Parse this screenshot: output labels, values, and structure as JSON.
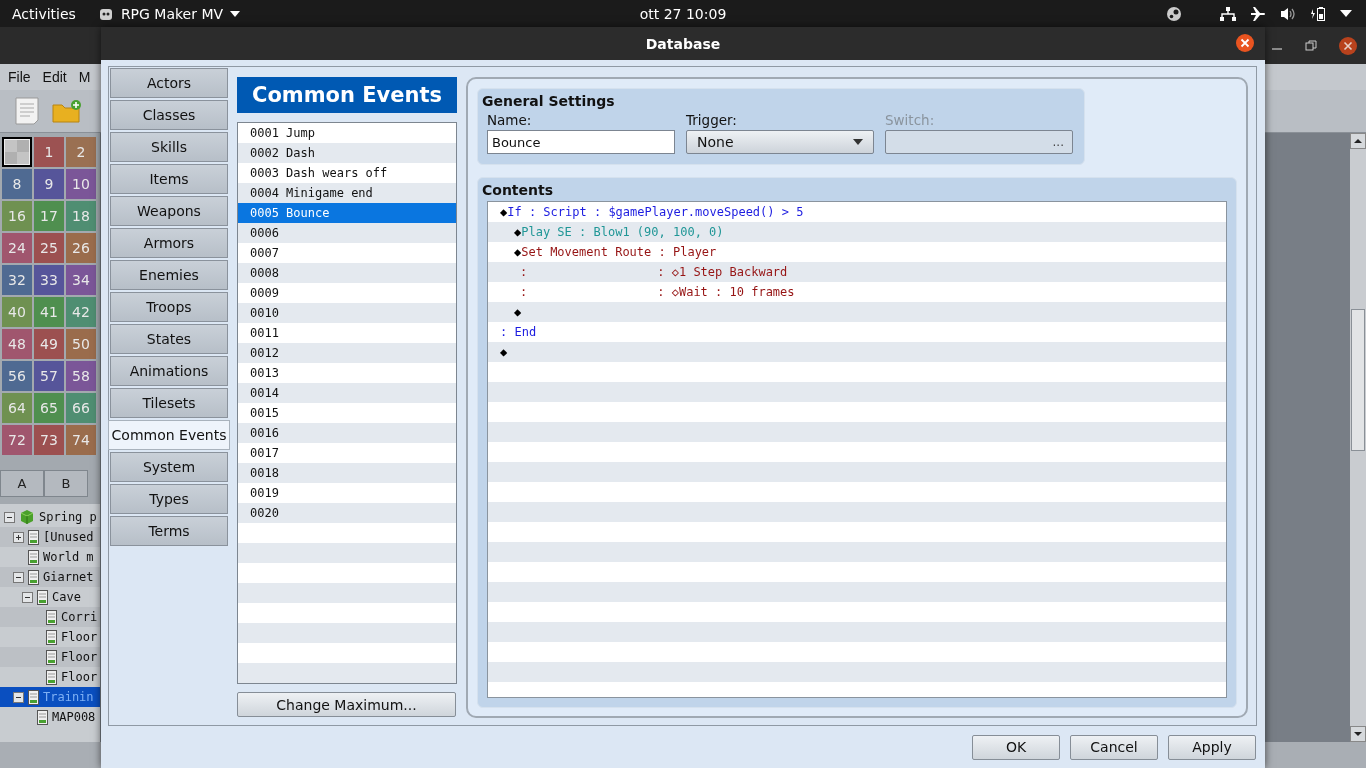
{
  "topbar": {
    "activities": "Activities",
    "app_menu": "RPG Maker MV",
    "clock": "ott 27 10:09"
  },
  "main_window": {
    "menu": [
      "File",
      "Edit",
      "M"
    ],
    "tiles": [
      {
        "kind": "blank",
        "selected": true
      },
      {
        "label": "1",
        "color": "#9c5252",
        "selected": false
      },
      {
        "label": "2",
        "color": "#9a7052",
        "selected": false
      },
      {
        "label": "8",
        "color": "#4f6a92",
        "selected": false
      },
      {
        "label": "9",
        "color": "#56559a",
        "selected": false
      },
      {
        "label": "10",
        "color": "#7b5698",
        "selected": false
      },
      {
        "label": "16",
        "color": "#6f9151",
        "selected": false
      },
      {
        "label": "17",
        "color": "#4f8f4f",
        "selected": false
      },
      {
        "label": "18",
        "color": "#4f8e72",
        "selected": false
      },
      {
        "label": "24",
        "color": "#a0566e",
        "selected": false
      },
      {
        "label": "25",
        "color": "#9c5050",
        "selected": false
      },
      {
        "label": "26",
        "color": "#9a6c4c",
        "selected": false
      },
      {
        "label": "32",
        "color": "#4f6a92",
        "selected": false
      },
      {
        "label": "33",
        "color": "#56559a",
        "selected": false
      },
      {
        "label": "34",
        "color": "#7b5698",
        "selected": false
      },
      {
        "label": "40",
        "color": "#6f9151",
        "selected": false
      },
      {
        "label": "41",
        "color": "#4f8f4f",
        "selected": false
      },
      {
        "label": "42",
        "color": "#4f8e72",
        "selected": false
      },
      {
        "label": "48",
        "color": "#a0566e",
        "selected": false
      },
      {
        "label": "49",
        "color": "#9c5050",
        "selected": false
      },
      {
        "label": "50",
        "color": "#9a6c4c",
        "selected": false
      },
      {
        "label": "56",
        "color": "#4f6a92",
        "selected": false
      },
      {
        "label": "57",
        "color": "#56559a",
        "selected": false
      },
      {
        "label": "58",
        "color": "#7b5698",
        "selected": false
      },
      {
        "label": "64",
        "color": "#6f9151",
        "selected": false
      },
      {
        "label": "65",
        "color": "#4f8f4f",
        "selected": false
      },
      {
        "label": "66",
        "color": "#4f8e72",
        "selected": false
      },
      {
        "label": "72",
        "color": "#a0566e",
        "selected": false
      },
      {
        "label": "73",
        "color": "#9c5050",
        "selected": false
      },
      {
        "label": "74",
        "color": "#9a6c4c",
        "selected": false
      }
    ],
    "tile_tabs": [
      "A",
      "B"
    ],
    "map_tree": [
      {
        "label": "Spring p",
        "kind": "project",
        "expanded": true,
        "selected": false,
        "children": [
          {
            "label": "[Unused",
            "kind": "map",
            "expanded": false,
            "selected": false
          },
          {
            "label": "World m",
            "kind": "map",
            "selected": false
          },
          {
            "label": "Giarnet",
            "kind": "map",
            "expanded": true,
            "selected": false,
            "children": [
              {
                "label": "Cave",
                "kind": "map",
                "expanded": true,
                "selected": false,
                "children": [
                  {
                    "label": "Corri",
                    "kind": "map",
                    "selected": false
                  },
                  {
                    "label": "Floor",
                    "kind": "map",
                    "selected": false
                  },
                  {
                    "label": "Floor",
                    "kind": "map",
                    "selected": false
                  },
                  {
                    "label": "Floor",
                    "kind": "map",
                    "selected": false
                  }
                ]
              }
            ]
          },
          {
            "label": "Trainin",
            "kind": "map",
            "expanded": true,
            "selected": true,
            "children": [
              {
                "label": "MAP008",
                "kind": "map",
                "selected": false
              }
            ]
          }
        ]
      }
    ]
  },
  "dialog": {
    "title": "Database",
    "categories": [
      {
        "label": "Actors",
        "selected": false
      },
      {
        "label": "Classes",
        "selected": false
      },
      {
        "label": "Skills",
        "selected": false
      },
      {
        "label": "Items",
        "selected": false
      },
      {
        "label": "Weapons",
        "selected": false
      },
      {
        "label": "Armors",
        "selected": false
      },
      {
        "label": "Enemies",
        "selected": false
      },
      {
        "label": "Troops",
        "selected": false
      },
      {
        "label": "States",
        "selected": false
      },
      {
        "label": "Animations",
        "selected": false
      },
      {
        "label": "Tilesets",
        "selected": false
      },
      {
        "label": "Common Events",
        "selected": true
      },
      {
        "label": "System",
        "selected": false
      },
      {
        "label": "Types",
        "selected": false
      },
      {
        "label": "Terms",
        "selected": false
      }
    ],
    "list_title": "Common Events",
    "events": [
      {
        "label": "0001 Jump",
        "selected": false
      },
      {
        "label": "0002 Dash",
        "selected": false
      },
      {
        "label": "0003 Dash wears off",
        "selected": false
      },
      {
        "label": "0004 Minigame end",
        "selected": false
      },
      {
        "label": "0005 Bounce",
        "selected": true
      },
      {
        "label": "0006",
        "selected": false
      },
      {
        "label": "0007",
        "selected": false
      },
      {
        "label": "0008",
        "selected": false
      },
      {
        "label": "0009",
        "selected": false
      },
      {
        "label": "0010",
        "selected": false
      },
      {
        "label": "0011",
        "selected": false
      },
      {
        "label": "0012",
        "selected": false
      },
      {
        "label": "0013",
        "selected": false
      },
      {
        "label": "0014",
        "selected": false
      },
      {
        "label": "0015",
        "selected": false
      },
      {
        "label": "0016",
        "selected": false
      },
      {
        "label": "0017",
        "selected": false
      },
      {
        "label": "0018",
        "selected": false
      },
      {
        "label": "0019",
        "selected": false
      },
      {
        "label": "0020",
        "selected": false
      }
    ],
    "change_max": "Change Maximum...",
    "general": {
      "title": "General Settings",
      "name_label": "Name:",
      "name_value": "Bounce",
      "trigger_label": "Trigger:",
      "trigger_value": "None",
      "switch_label": "Switch:",
      "switch_disabled": true,
      "switch_button": "..."
    },
    "contents": {
      "title": "Contents",
      "commands": [
        {
          "kind": "command",
          "marker": "◆",
          "text": "If : Script : $gamePlayer.moveSpeed() > 5",
          "color": "#1c1ce0",
          "children": [
            {
              "kind": "command",
              "marker": "◆",
              "text": "Play SE : Blow1 (90, 100, 0)",
              "color": "#1f9696"
            },
            {
              "kind": "command",
              "marker": "◆",
              "text": "Set Movement Route : Player",
              "color": "#961414"
            },
            {
              "kind": "route",
              "text": ":                  : ◇1 Step Backward",
              "color": "#961414"
            },
            {
              "kind": "route",
              "text": ":                  : ◇Wait : 10 frames",
              "color": "#961414"
            },
            {
              "kind": "command",
              "marker": "◆"
            }
          ]
        },
        {
          "kind": "command",
          "text": ": End",
          "color": "#1c1ce0"
        },
        {
          "kind": "command",
          "marker": "◆"
        }
      ]
    },
    "buttons": [
      "OK",
      "Cancel",
      "Apply"
    ]
  }
}
